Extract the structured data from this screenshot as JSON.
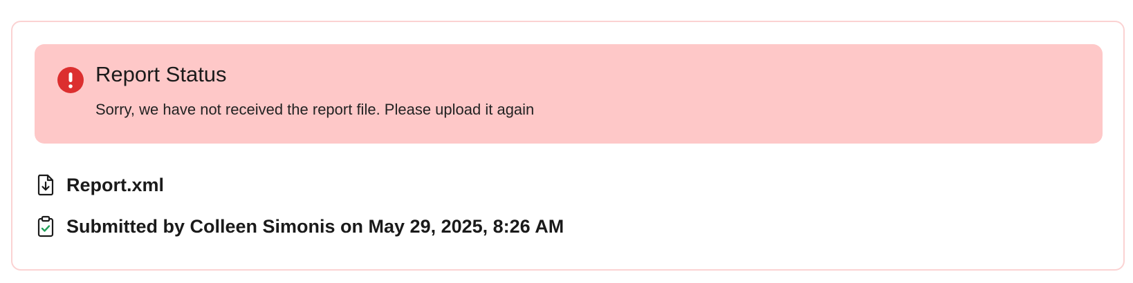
{
  "alert": {
    "icon": "exclamation-circle-icon",
    "title": "Report Status",
    "message": "Sorry, we have not received the report file. Please upload it again",
    "background_color": "#fec8c8",
    "icon_color": "#dc2f2f"
  },
  "file": {
    "icon": "file-download-icon",
    "name": "Report.xml"
  },
  "submission": {
    "icon": "clipboard-check-icon",
    "text": "Submitted by Colleen Simonis on May 29, 2025, 8:26 AM",
    "check_color": "#22a05a"
  },
  "card": {
    "border_color": "#fbd2d2"
  }
}
